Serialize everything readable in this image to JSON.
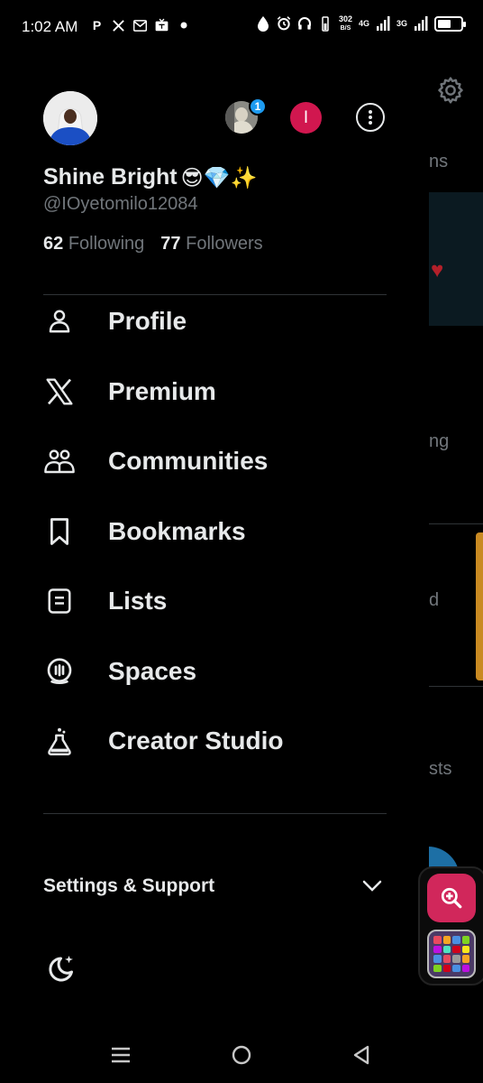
{
  "status_bar": {
    "time": "1:02 AM",
    "left_icons": [
      "p-app-icon",
      "x-icon",
      "mail-icon",
      "tv-icon",
      "dot-icon"
    ],
    "speed_value": "302",
    "speed_unit": "B/S",
    "net1": "4G",
    "net2": "3G"
  },
  "background": {
    "partial_text_1": "ns",
    "partial_text_2": "ng",
    "partial_text_3": "d",
    "partial_text_4": "sts"
  },
  "drawer": {
    "account_badge": "1",
    "account_initial": "I",
    "profile": {
      "name": "Shine Bright",
      "name_emojis": "😎💎✨",
      "handle": "@IOyetomilo12084",
      "following_count": "62",
      "following_label": "Following",
      "followers_count": "77",
      "followers_label": "Followers"
    },
    "menu": [
      {
        "label": "Profile",
        "icon": "person-icon"
      },
      {
        "label": "Premium",
        "icon": "x-logo-icon"
      },
      {
        "label": "Communities",
        "icon": "communities-icon"
      },
      {
        "label": "Bookmarks",
        "icon": "bookmark-icon"
      },
      {
        "label": "Lists",
        "icon": "list-icon"
      },
      {
        "label": "Spaces",
        "icon": "spaces-icon"
      },
      {
        "label": "Creator Studio",
        "icon": "flask-icon"
      }
    ],
    "settings_label": "Settings & Support"
  },
  "colors": {
    "background": "#000000",
    "text_primary": "#e7e9ea",
    "text_secondary": "#71767b",
    "accent_blue": "#1d9bf0",
    "avatar_pink": "#d1174f",
    "divider": "#2f3336"
  }
}
